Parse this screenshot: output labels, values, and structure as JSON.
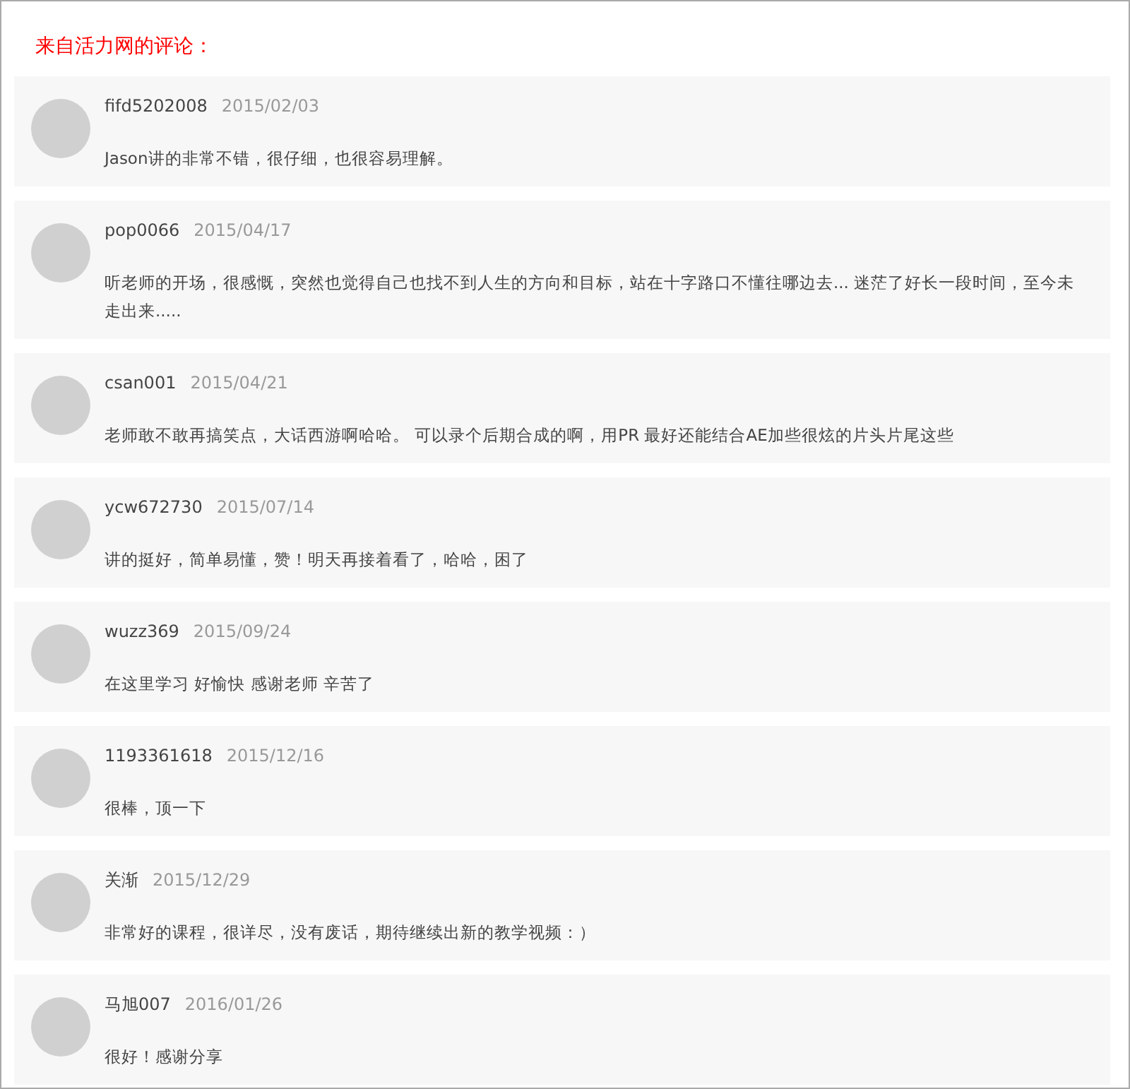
{
  "heading": "来自活力网的评论：",
  "comments": [
    {
      "user": "fifd5202008",
      "date": "2015/02/03",
      "text": "Jason讲的非常不错，很仔细，也很容易理解。"
    },
    {
      "user": "pop0066",
      "date": "2015/04/17",
      "text": "听老师的开场，很感慨，突然也觉得自己也找不到人生的方向和目标，站在十字路口不懂往哪边去... 迷茫了好长一段时间，至今未走出来....."
    },
    {
      "user": "csan001",
      "date": "2015/04/21",
      "text": "老师敢不敢再搞笑点，大话西游啊哈哈。 可以录个后期合成的啊，用PR 最好还能结合AE加些很炫的片头片尾这些"
    },
    {
      "user": "ycw672730",
      "date": "2015/07/14",
      "text": "讲的挺好，简单易懂，赞！明天再接着看了，哈哈，困了"
    },
    {
      "user": "wuzz369",
      "date": "2015/09/24",
      "text": "在这里学习 好愉快 感谢老师 辛苦了"
    },
    {
      "user": "1193361618",
      "date": "2015/12/16",
      "text": "很棒，顶一下"
    },
    {
      "user": "关渐",
      "date": "2015/12/29",
      "text": "非常好的课程，很详尽，没有废话，期待继续出新的教学视频：）"
    },
    {
      "user": "马旭007",
      "date": "2016/01/26",
      "text": "很好！感谢分享"
    }
  ]
}
